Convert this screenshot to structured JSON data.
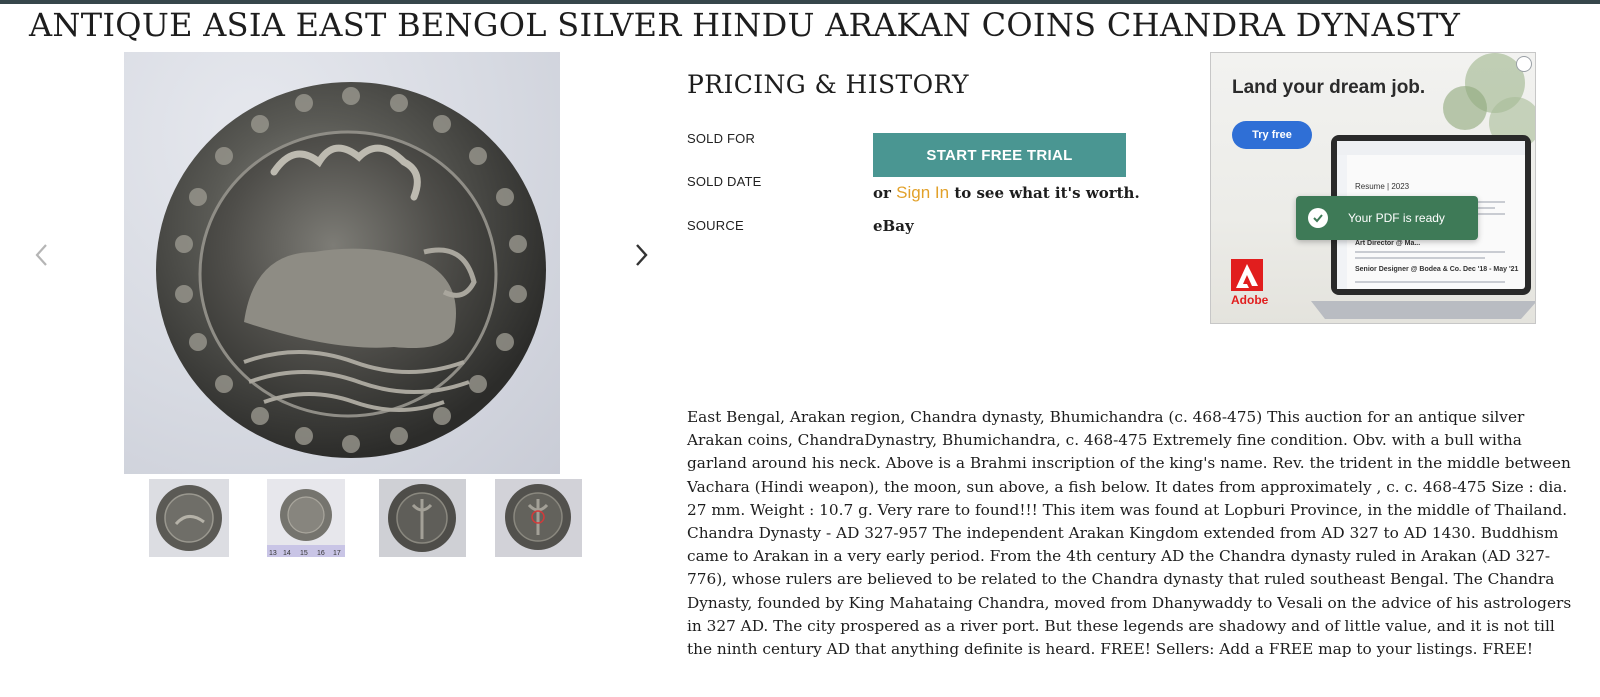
{
  "listing": {
    "title": "ANTIQUE ASIA EAST BENGOL SILVER HINDU ARAKAN COINS CHANDRA DYNASTY"
  },
  "gallery": {
    "main_image": "coin-obverse-bull",
    "thumbnails": [
      "coin-obverse-bull",
      "coin-with-ruler",
      "coin-reverse-trident",
      "coin-reverse-annotated"
    ],
    "ruler_marks": [
      "13",
      "14",
      "15",
      "16",
      "17"
    ]
  },
  "pricing": {
    "heading": "PRICING & HISTORY",
    "labels": {
      "sold_for": "SOLD FOR",
      "sold_date": "SOLD DATE",
      "source": "SOURCE"
    },
    "trial_button": "START FREE TRIAL",
    "signin_prefix": "or",
    "signin_link": "Sign In",
    "signin_suffix": "to see what it's worth.",
    "source_value": "eBay",
    "button_color": "#4a9692",
    "link_color": "#e2a12a"
  },
  "ad": {
    "headline": "Land your dream job.",
    "cta": "Try free",
    "toast": "Your PDF is ready",
    "resume_heading": "Resume | 2023",
    "resume_line_1": "Art Director @ Ma...",
    "resume_line_2": "Senior Designer @ Bodea & Co. Dec '18 - May '21",
    "brand": "Adobe",
    "brand_color": "#e11e1e"
  },
  "description": "East Bengal, Arakan region, Chandra dynasty, Bhumichandra (c. 468-475) This auction for an antique silver Arakan coins, ChandraDynastry, Bhumichandra, c. 468-475 Extremely fine condition. Obv. with a bull witha garland around his neck. Above is a Brahmi inscription of the king's name. Rev. the trident in the middle between Vachara (Hindi weapon), the moon, sun above, a fish below. It dates from approximately , c. c. 468-475 Size : dia. 27 mm. Weight : 10.7 g. Very rare to found!!! This item was found at Lopburi Province, in the middle of Thailand. Chandra Dynasty - AD 327-957 The independent Arakan Kingdom extended from AD 327 to AD 1430. Buddhism came to Arakan in a very early period. From the 4th century AD the Chandra dynasty ruled in Arakan (AD 327-776), whose rulers are believed to be related to the Chandra dynasty that ruled southeast Bengal. The Chandra Dynasty, founded by King Mahataing Chandra, moved from Dhanywaddy to Vesali on the advice of his astrologers in 327 AD. The city prospered as a river port. But these legends are shadowy and of little value, and it is not till the ninth century AD that anything definite is heard. FREE! Sellers: Add a FREE map to your listings. FREE!"
}
